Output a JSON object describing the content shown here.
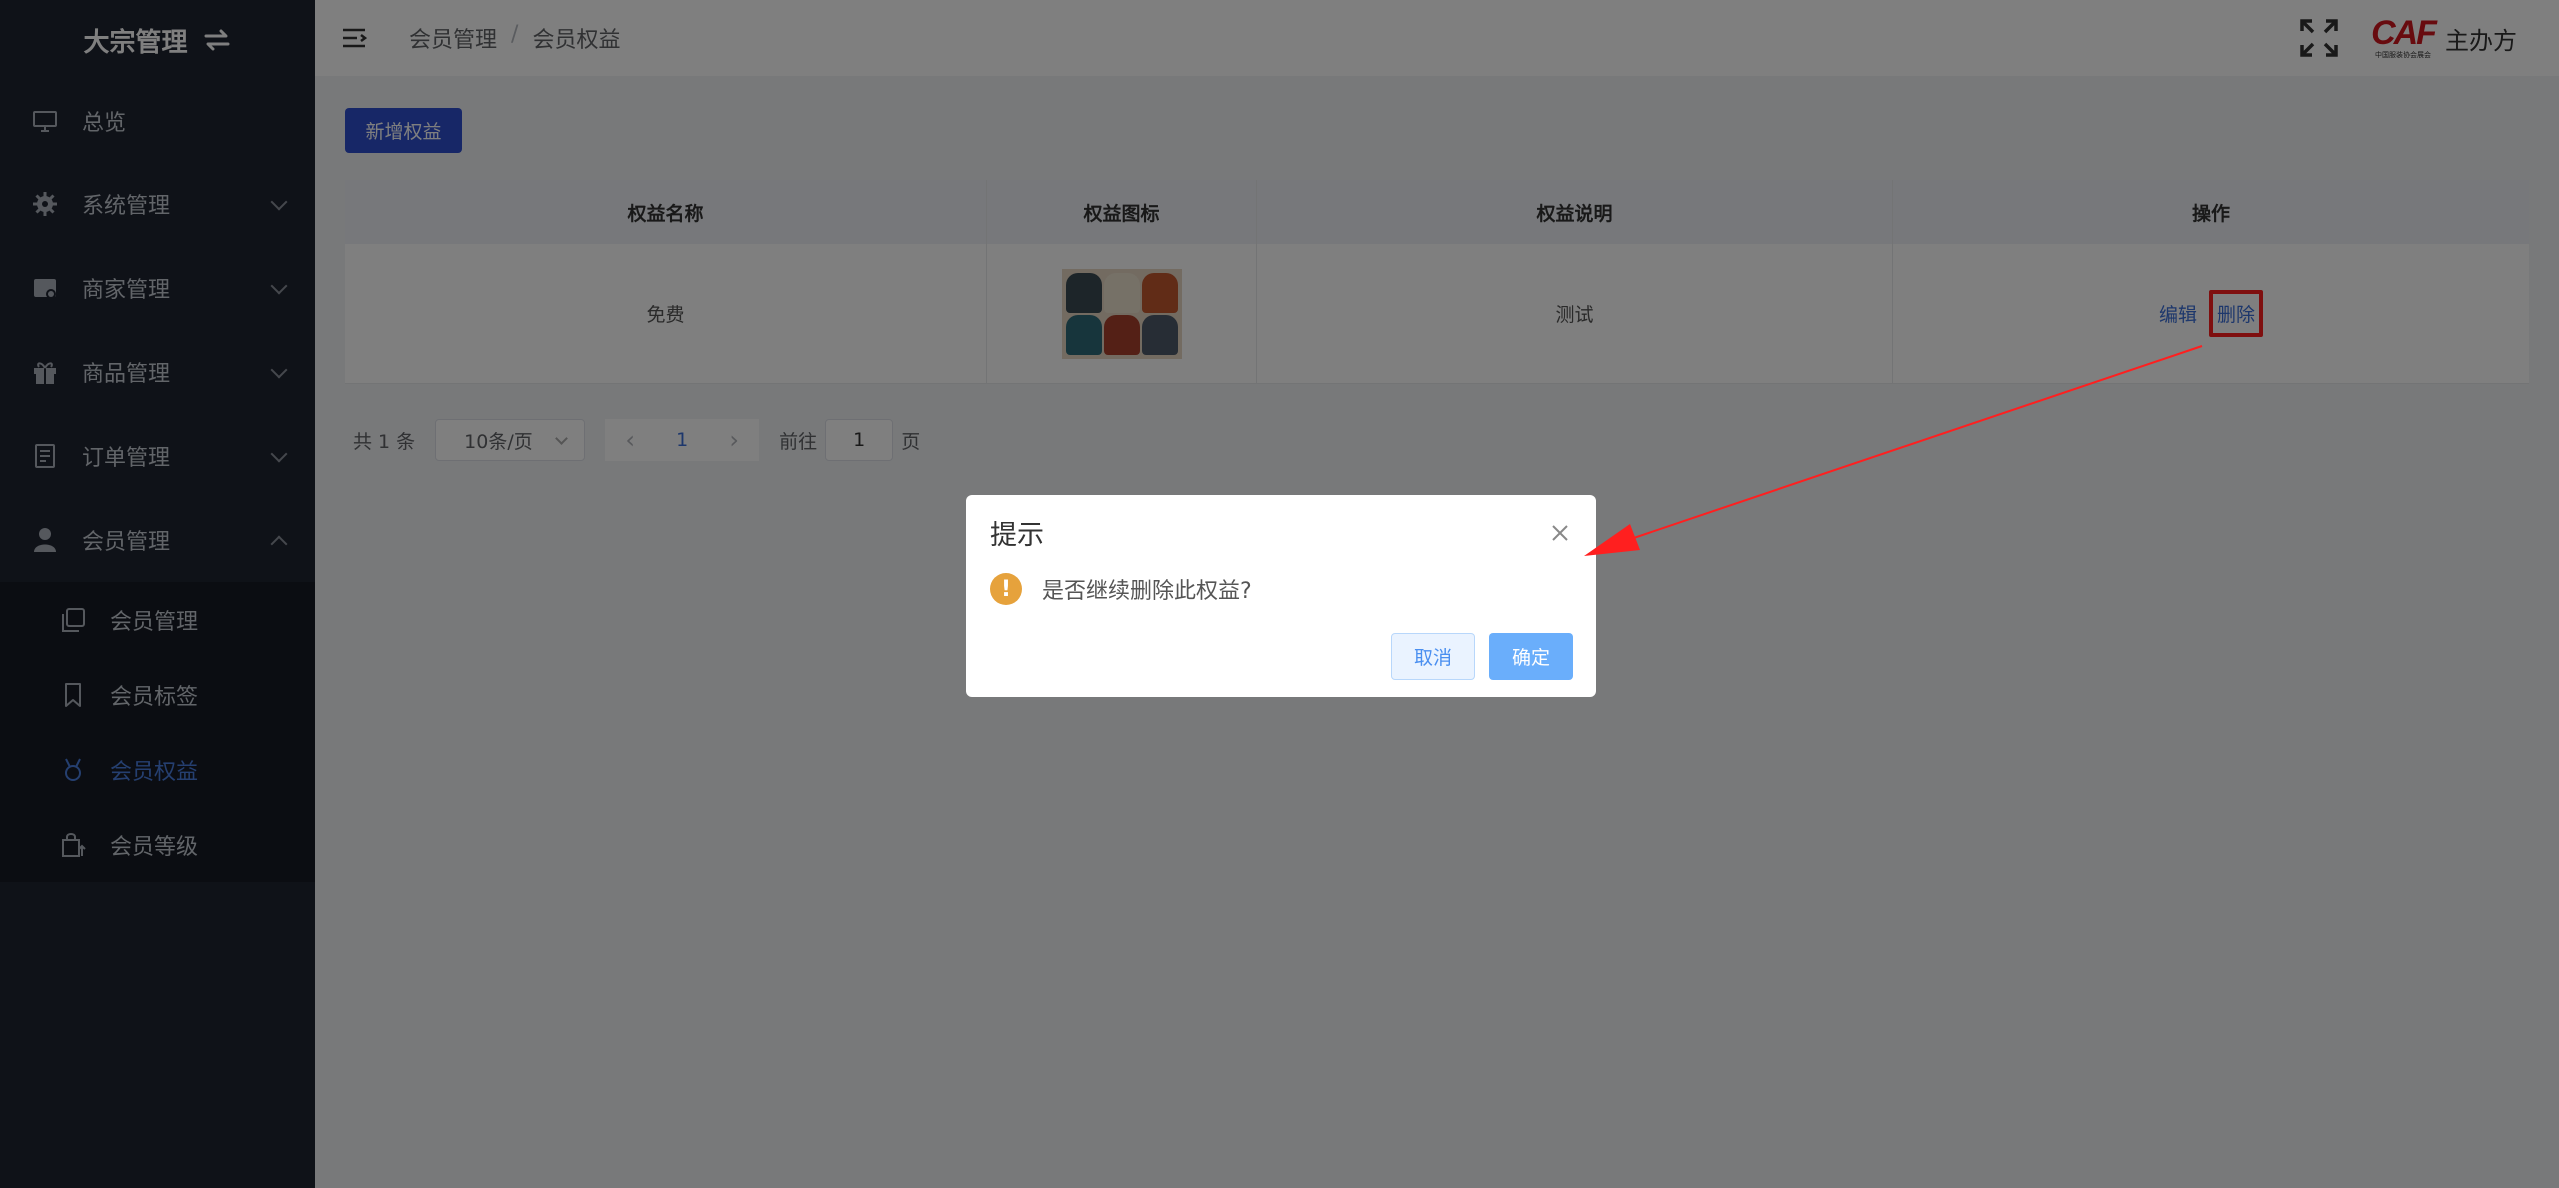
{
  "sidebar": {
    "title": "大宗管理",
    "items": [
      {
        "label": "总览",
        "icon": "monitor-icon"
      },
      {
        "label": "系统管理",
        "icon": "gear-icon"
      },
      {
        "label": "商家管理",
        "icon": "store-icon"
      },
      {
        "label": "商品管理",
        "icon": "gift-icon"
      },
      {
        "label": "订单管理",
        "icon": "order-icon"
      },
      {
        "label": "会员管理",
        "icon": "user-icon"
      }
    ],
    "subitems": [
      {
        "label": "会员管理",
        "icon": "copy-icon"
      },
      {
        "label": "会员标签",
        "icon": "bookmark-icon"
      },
      {
        "label": "会员权益",
        "icon": "medal-icon",
        "active": true
      },
      {
        "label": "会员等级",
        "icon": "bag-upgrade-icon"
      }
    ]
  },
  "header": {
    "breadcrumb": [
      "会员管理",
      "会员权益"
    ],
    "breadcrumb_sep": "/",
    "logo_text": "CAF",
    "logo_subtext": "中国服装协会展会",
    "username": "主办方"
  },
  "toolbar": {
    "add_label": "新增权益"
  },
  "table": {
    "columns": [
      "权益名称",
      "权益图标",
      "权益说明",
      "操作"
    ],
    "rows": [
      {
        "name": "免费",
        "icon": "skirt-thumbnail",
        "description": "测试",
        "edit": "编辑",
        "delete": "删除"
      }
    ]
  },
  "pagination": {
    "total": "共 1 条",
    "page_size": "10条/页",
    "current": "1",
    "goto_label": "前往",
    "goto_value": "1",
    "page_suffix": "页"
  },
  "dialog": {
    "title": "提示",
    "message": "是否继续删除此权益?",
    "cancel": "取消",
    "confirm": "确定"
  },
  "colors": {
    "sidebar_bg": "#1f2430",
    "accent": "#2f4fcf",
    "active_link": "#4a7fe0",
    "warning": "#e6a23c",
    "annotation_red": "#ff1f1f"
  }
}
